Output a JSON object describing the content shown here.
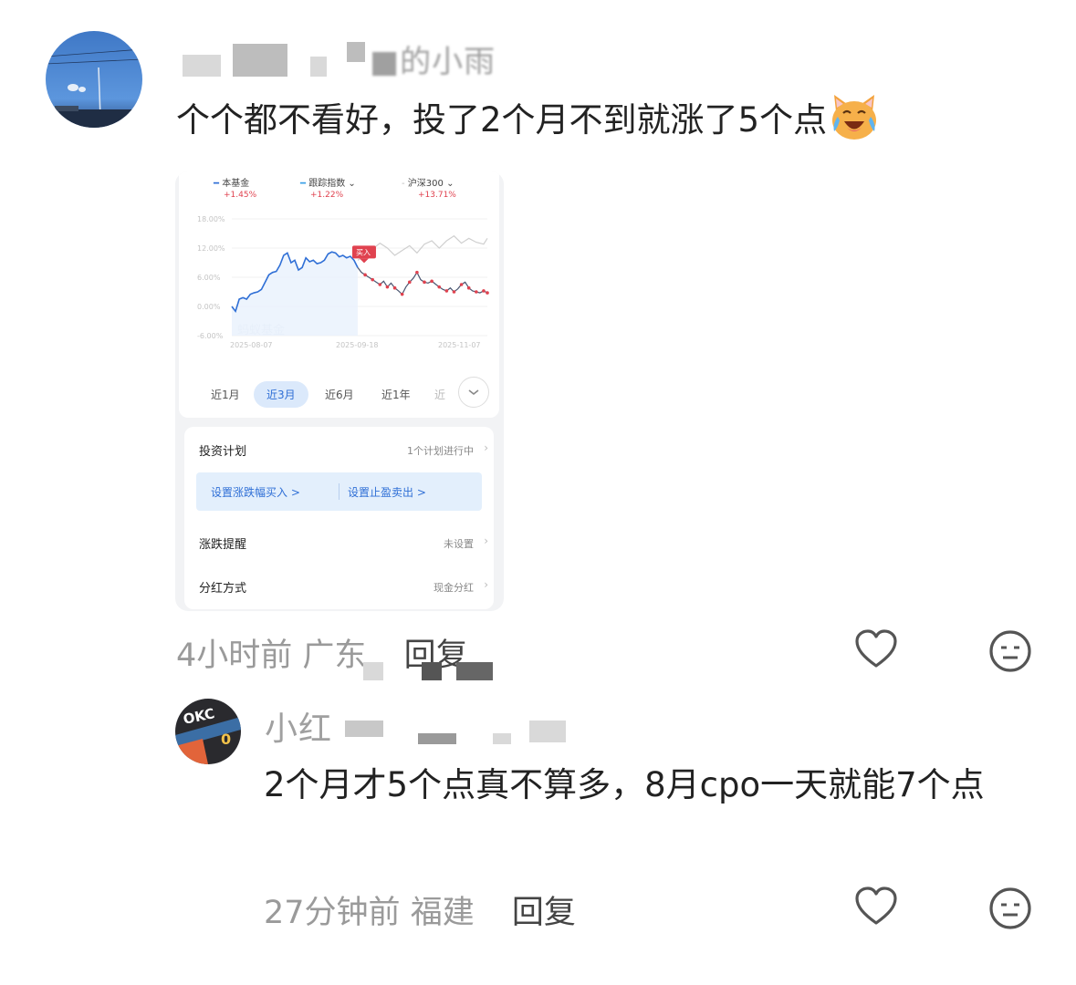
{
  "colors": {
    "text_primary": "#222222",
    "text_meta": "#9a9a9a",
    "fund_line": "#2f6fd6",
    "index_line": "#3aa0e6",
    "hs300_line": "#cfcfcf",
    "buy_marker": "#e0424f",
    "positive": "#e0424f"
  },
  "main_comment": {
    "username": "■的小雨",
    "text": "个个都不看好，投了2个月不到就涨了5个点",
    "emoji": "laughing-cat-with-tears-icon",
    "time": "4小时前",
    "location": "广东",
    "reply_label": "回复"
  },
  "reply_comment": {
    "username": "小红",
    "avatar_text": "OKC",
    "avatar_number": "0",
    "text": "2个月才5个点真不算多，8月cpo一天就能7个点",
    "time": "27分钟前",
    "location": "福建",
    "reply_label": "回复"
  },
  "fund_screenshot": {
    "legend": [
      {
        "name": "本基金",
        "value": "+1.45%"
      },
      {
        "name": "跟踪指数",
        "value": "+1.22%"
      },
      {
        "name": "沪深300",
        "value": "+13.71%"
      }
    ],
    "watermark": "蚂蚁基金",
    "buy_label": "买入",
    "range_tabs": [
      "近1月",
      "近3月",
      "近6月",
      "近1年",
      "近"
    ],
    "active_range": "近3月",
    "plan_title": "投资计划",
    "plan_status": "1个计划进行中",
    "plan_buttons": [
      "设置涨跌幅买入 >",
      "设置止盈卖出 >"
    ],
    "alert_label": "涨跌提醒",
    "alert_value": "未设置",
    "dividend_label": "分红方式",
    "dividend_value": "现金分红"
  },
  "chart_data": {
    "type": "line",
    "yticks": [
      "18.00%",
      "12.00%",
      "6.00%",
      "0.00%",
      "-6.00%"
    ],
    "ylim": [
      -6,
      18
    ],
    "xticks": [
      "2025-08-07",
      "2025-09-18",
      "2025-11-07"
    ],
    "series": [
      {
        "name": "本基金",
        "x_index": [
          0,
          1,
          2,
          3,
          4,
          5,
          6,
          7,
          8,
          9,
          10,
          11,
          12,
          13,
          14,
          15,
          16,
          17,
          18,
          19,
          20,
          21,
          22,
          23,
          24,
          25,
          26,
          27,
          28,
          29,
          30,
          31,
          32,
          33,
          34,
          35,
          36,
          37,
          38,
          39,
          40,
          41,
          42,
          43,
          44,
          45,
          46,
          47,
          48,
          49,
          50,
          51,
          52,
          53,
          54,
          55,
          56,
          57,
          58,
          59,
          60,
          61,
          62,
          63,
          64,
          65,
          66,
          67,
          68,
          69
        ],
        "values": [
          0.0,
          -1.0,
          1.5,
          1.8,
          1.5,
          2.5,
          2.8,
          3.0,
          3.5,
          5.0,
          6.5,
          7.0,
          7.2,
          8.5,
          10.5,
          11.0,
          9.0,
          9.5,
          7.5,
          8.0,
          10.0,
          9.2,
          9.5,
          8.8,
          9.0,
          9.5,
          10.8,
          11.2,
          11.0,
          10.2,
          10.5,
          10.0,
          10.3,
          9.5,
          8.0,
          7.0,
          6.5,
          6.0,
          5.5,
          5.0,
          4.5,
          5.2,
          4.0,
          4.8,
          3.8,
          3.2,
          2.5,
          4.0,
          5.0,
          5.8,
          7.0,
          5.5,
          5.0,
          4.8,
          5.2,
          4.6,
          4.0,
          3.5,
          3.2,
          3.8,
          3.0,
          3.6,
          4.5,
          5.0,
          3.8,
          3.2,
          3.0,
          2.8,
          3.2,
          2.8
        ]
      },
      {
        "name": "沪深300",
        "x_index": [
          34,
          36,
          38,
          40,
          42,
          44,
          46,
          48,
          50,
          52,
          54,
          56,
          58,
          60,
          62,
          64,
          66,
          68,
          69
        ],
        "values": [
          9.5,
          10.5,
          11.8,
          13.0,
          12.0,
          10.5,
          11.5,
          12.5,
          11.0,
          12.8,
          13.5,
          12.0,
          13.5,
          14.5,
          13.0,
          14.0,
          13.2,
          12.8,
          14.0
        ]
      }
    ],
    "buy_point_index": 34
  },
  "icons": {
    "like": "heart-outline-icon",
    "dislike": "meh-face-icon"
  }
}
